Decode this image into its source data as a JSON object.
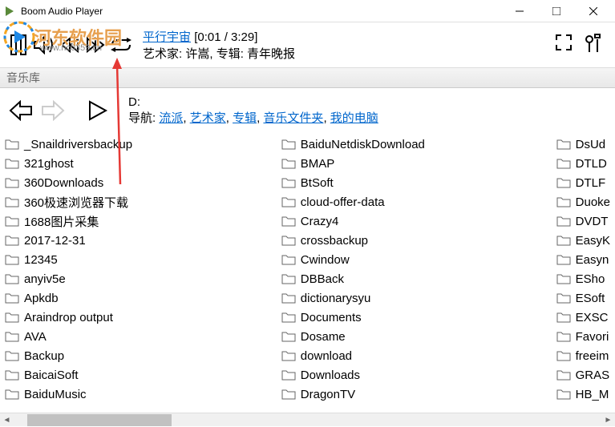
{
  "titlebar": {
    "title": "Boom Audio Player"
  },
  "watermark": {
    "text": "河东软件园",
    "url": "www.nc0359.cn"
  },
  "playing": {
    "title": "平行宇宙",
    "time": "[0:01 / 3:29]",
    "artist_label": "艺术家:",
    "artist": "许嵩",
    "album_label": "专辑:",
    "album": "青年晚报"
  },
  "library": {
    "header": "音乐库"
  },
  "path": {
    "drive": "D:",
    "nav_label": "导航:",
    "links": [
      "流派",
      "艺术家",
      "专辑",
      "音乐文件夹",
      "我的电脑"
    ]
  },
  "folders": {
    "col1": [
      "_Snaildriversbackup",
      "321ghost",
      "360Downloads",
      "360极速浏览器下载",
      "1688图片采集",
      "2017-12-31",
      "12345",
      "anyiv5e",
      "Apkdb",
      "Araindrop output",
      "AVA",
      "Backup",
      "BaicaiSoft",
      "BaiduMusic"
    ],
    "col2": [
      "BaiduNetdiskDownload",
      "BMAP",
      "BtSoft",
      "cloud-offer-data",
      "Crazy4",
      "crossbackup",
      "Cwindow",
      "DBBack",
      "dictionarysyu",
      "Documents",
      "Dosame",
      "download",
      "Downloads",
      "DragonTV"
    ],
    "col3": [
      "DsUd",
      "DTLD",
      "DTLF",
      "Duoke",
      "DVDT",
      "EasyK",
      "Easyn",
      "ESho",
      "ESoft",
      "EXSC",
      "Favori",
      "freeim",
      "GRAS",
      "HB_M"
    ]
  }
}
